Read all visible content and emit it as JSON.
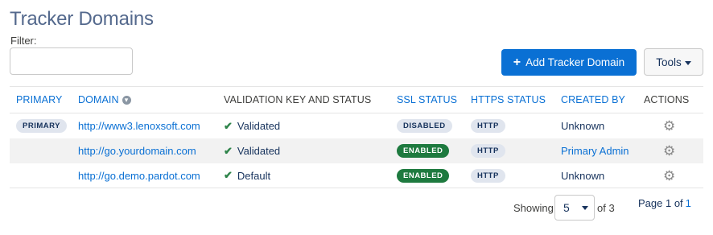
{
  "page": {
    "title": "Tracker Domains",
    "filter_label": "Filter:",
    "filter_value": ""
  },
  "toolbar": {
    "add_label": "Add Tracker Domain",
    "add_icon": "plus-icon",
    "tools_label": "Tools",
    "accent_color": "#0a70d4"
  },
  "table": {
    "headers": {
      "primary": "PRIMARY",
      "domain": "DOMAIN",
      "validation": "VALIDATION KEY AND STATUS",
      "ssl": "SSL STATUS",
      "https": "HTTPS STATUS",
      "created_by": "CREATED BY",
      "actions": "ACTIONS"
    },
    "rows": [
      {
        "primary": "PRIMARY",
        "domain": "http://www3.lenoxsoft.com",
        "validation": "Validated",
        "ssl": "DISABLED",
        "https": "HTTP",
        "created_by": "Unknown"
      },
      {
        "primary": "",
        "domain": "http://go.yourdomain.com",
        "validation": "Validated",
        "ssl": "ENABLED",
        "https": "HTTP",
        "created_by": "Primary Admin"
      },
      {
        "primary": "",
        "domain": "http://go.demo.pardot.com",
        "validation": "Default",
        "ssl": "ENABLED",
        "https": "HTTP",
        "created_by": "Unknown"
      }
    ],
    "status_colors": {
      "enabled": "#1e7a3f",
      "disabled": "#e0e5ee"
    }
  },
  "pagination": {
    "showing_label": "Showing",
    "page_size": "5",
    "of_total": "of 3",
    "page_label": "Page 1 of",
    "total_pages": "1"
  }
}
